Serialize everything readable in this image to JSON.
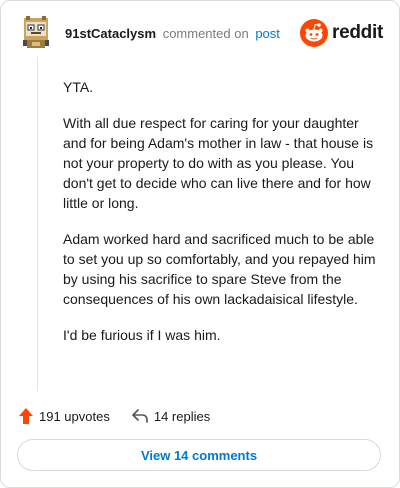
{
  "header": {
    "username": "91stCataclysm",
    "commented_text": "commented on",
    "post_link": "post",
    "logo_text": "reddit",
    "brand_color": "#ff4500",
    "avatar_icon": "pixel-robot-avatar"
  },
  "comment": {
    "paragraphs": [
      "YTA.",
      "With all due respect for caring for your daughter and for being Adam's mother in law - that house is not your property to do with as you please. You don't get to decide who can live there and for how little or long.",
      "Adam worked hard and sacrificed much to be able to set you up so comfortably, and you repayed him by using his sacrifice to spare Steve from the consequences of his own lackadaisical lifestyle.",
      "I'd be furious if I was him."
    ]
  },
  "actions": {
    "upvotes_label": "191 upvotes",
    "replies_label": "14 replies",
    "upvote_color": "#ff4500"
  },
  "footer": {
    "view_button_label": "View 14 comments",
    "link_color": "#0079d3"
  }
}
